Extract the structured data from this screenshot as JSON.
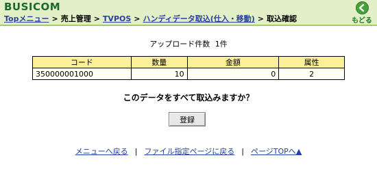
{
  "header": {
    "logo": "BUSICOM",
    "back_label": "もどる"
  },
  "breadcrumb": {
    "items": [
      "Topメニュー",
      "売上管理",
      "TVPOS",
      "ハンディデータ取込(仕入・移動)"
    ],
    "current": "取込確認",
    "separator": ">"
  },
  "summary": {
    "label": "アップロード件数",
    "count": "1件"
  },
  "table": {
    "headers": [
      "コード",
      "数量",
      "金額",
      "属性"
    ],
    "rows": [
      [
        "350000001000",
        "10",
        "0",
        "2"
      ]
    ]
  },
  "question": "このデータをすべて取込みますか？",
  "register_button": "登録",
  "footer": {
    "separator": "|",
    "links": [
      "メニューへ戻る",
      "ファイル指定ページに戻る",
      "ページTOPへ▲"
    ]
  },
  "colors": {
    "header_bg": "#e3efc7",
    "header_line": "#a9c96b",
    "table_header_bg": "#fcef99",
    "link": "#2740a8",
    "logo": "#1b6a2b"
  }
}
